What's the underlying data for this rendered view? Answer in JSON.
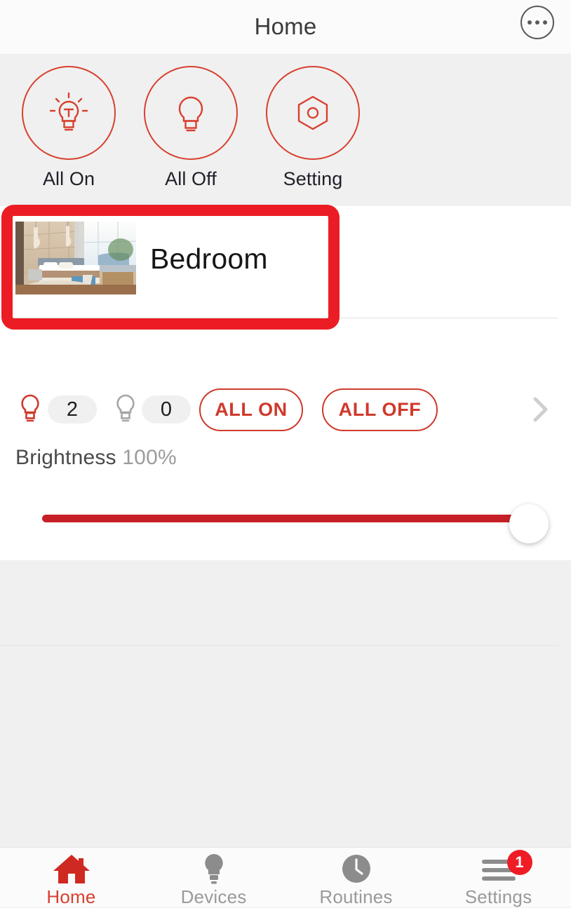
{
  "header": {
    "title": "Home",
    "more_icon": "more-options-circle-icon"
  },
  "scenes": [
    {
      "label": "All On",
      "icon": "bulb-on-icon"
    },
    {
      "label": "All Off",
      "icon": "bulb-off-icon"
    },
    {
      "label": "Setting",
      "icon": "hexagon-setting-icon"
    }
  ],
  "room": {
    "name": "Bedroom",
    "thumbnail_alt": "bedroom-photo",
    "lights_on_count": "2",
    "lights_off_count": "0",
    "all_on_label": "ALL ON",
    "all_off_label": "ALL OFF",
    "chevron_icon": "chevron-right-icon"
  },
  "brightness": {
    "label": "Brightness",
    "value": "100%",
    "percent": 100
  },
  "highlight": {
    "target": "bedroom-room-card",
    "color": "#ec1c24"
  },
  "tabs": [
    {
      "label": "Home",
      "icon": "house-icon",
      "active": true,
      "badge": ""
    },
    {
      "label": "Devices",
      "icon": "bulb-icon",
      "active": false,
      "badge": ""
    },
    {
      "label": "Routines",
      "icon": "clock-icon",
      "active": false,
      "badge": ""
    },
    {
      "label": "Settings",
      "icon": "hamburger-icon",
      "active": false,
      "badge": "1"
    }
  ],
  "colors": {
    "accent_red": "#d8402f",
    "highlight_red": "#ec1c24",
    "slider_red": "#c62026",
    "inactive_gray": "#9a9a9a"
  }
}
